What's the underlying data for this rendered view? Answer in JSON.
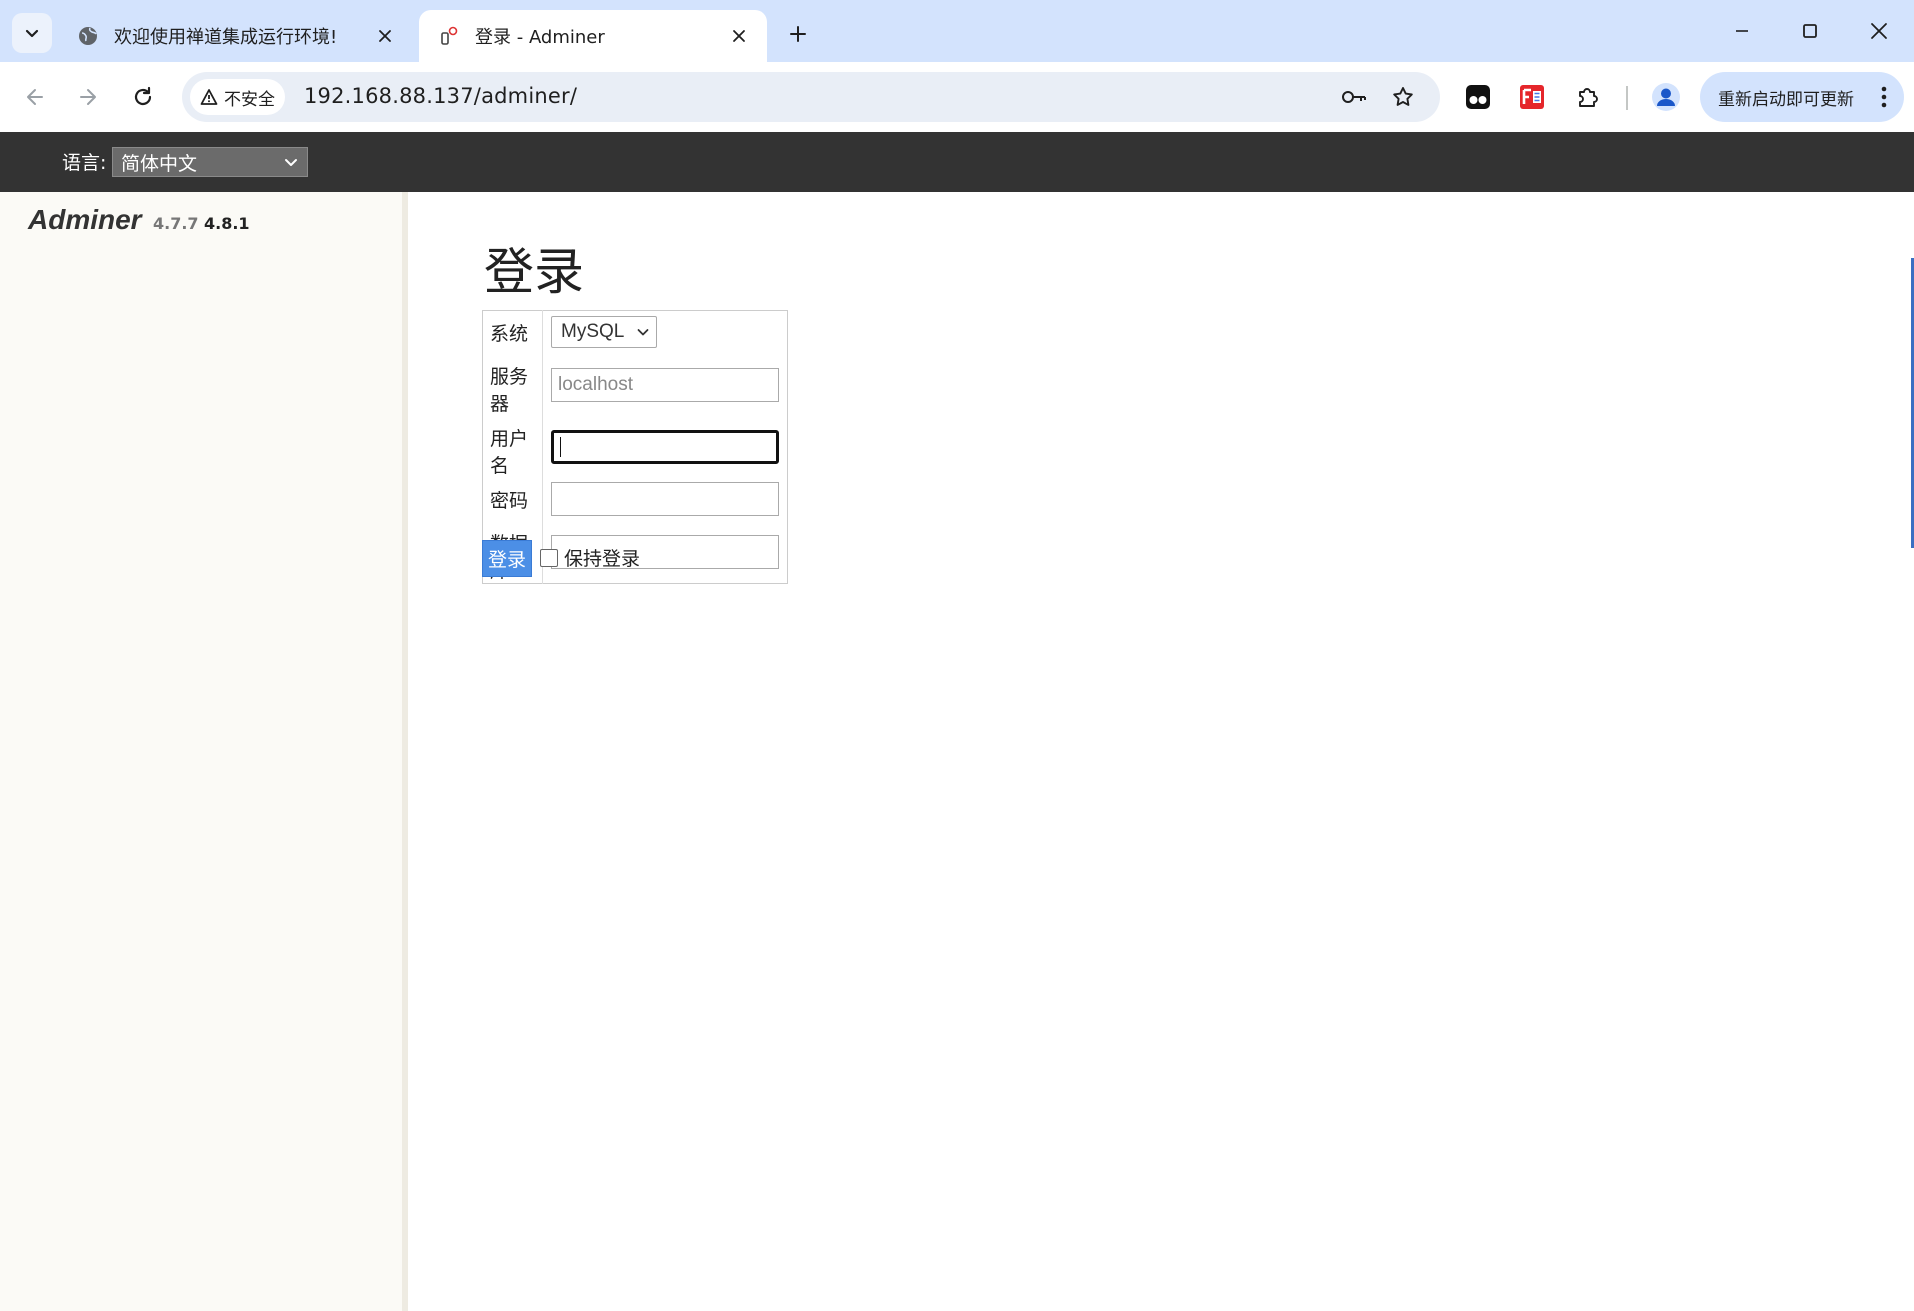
{
  "browser": {
    "tabs": [
      {
        "title": "欢迎使用禅道集成运行环境!",
        "active": false,
        "favicon": "globe-icon"
      },
      {
        "title": "登录 - Adminer",
        "active": true,
        "favicon": "adminer-icon"
      }
    ],
    "security_label": "不安全",
    "url": "192.168.88.137/adminer/",
    "update_button": "重新启动即可更新",
    "colors": {
      "tabstrip": "#d3e3fd",
      "omnibox": "#e9eef6"
    }
  },
  "adminer": {
    "language_label": "语言:",
    "language_value": "简体中文",
    "brand": "Adminer",
    "version_current": "4.7.7",
    "version_new": "4.8.1",
    "page_title": "登录",
    "form": {
      "system_label": "系统",
      "system_value": "MySQL",
      "server_label": "服务器",
      "server_placeholder": "localhost",
      "username_label": "用户名",
      "username_value": "",
      "password_label": "密码",
      "database_label": "数据库"
    },
    "login_button": "登录",
    "remember_label": "保持登录",
    "colors": {
      "header": "#333333",
      "menu": "#fbfaf6",
      "button": "#4c8fe6"
    }
  }
}
